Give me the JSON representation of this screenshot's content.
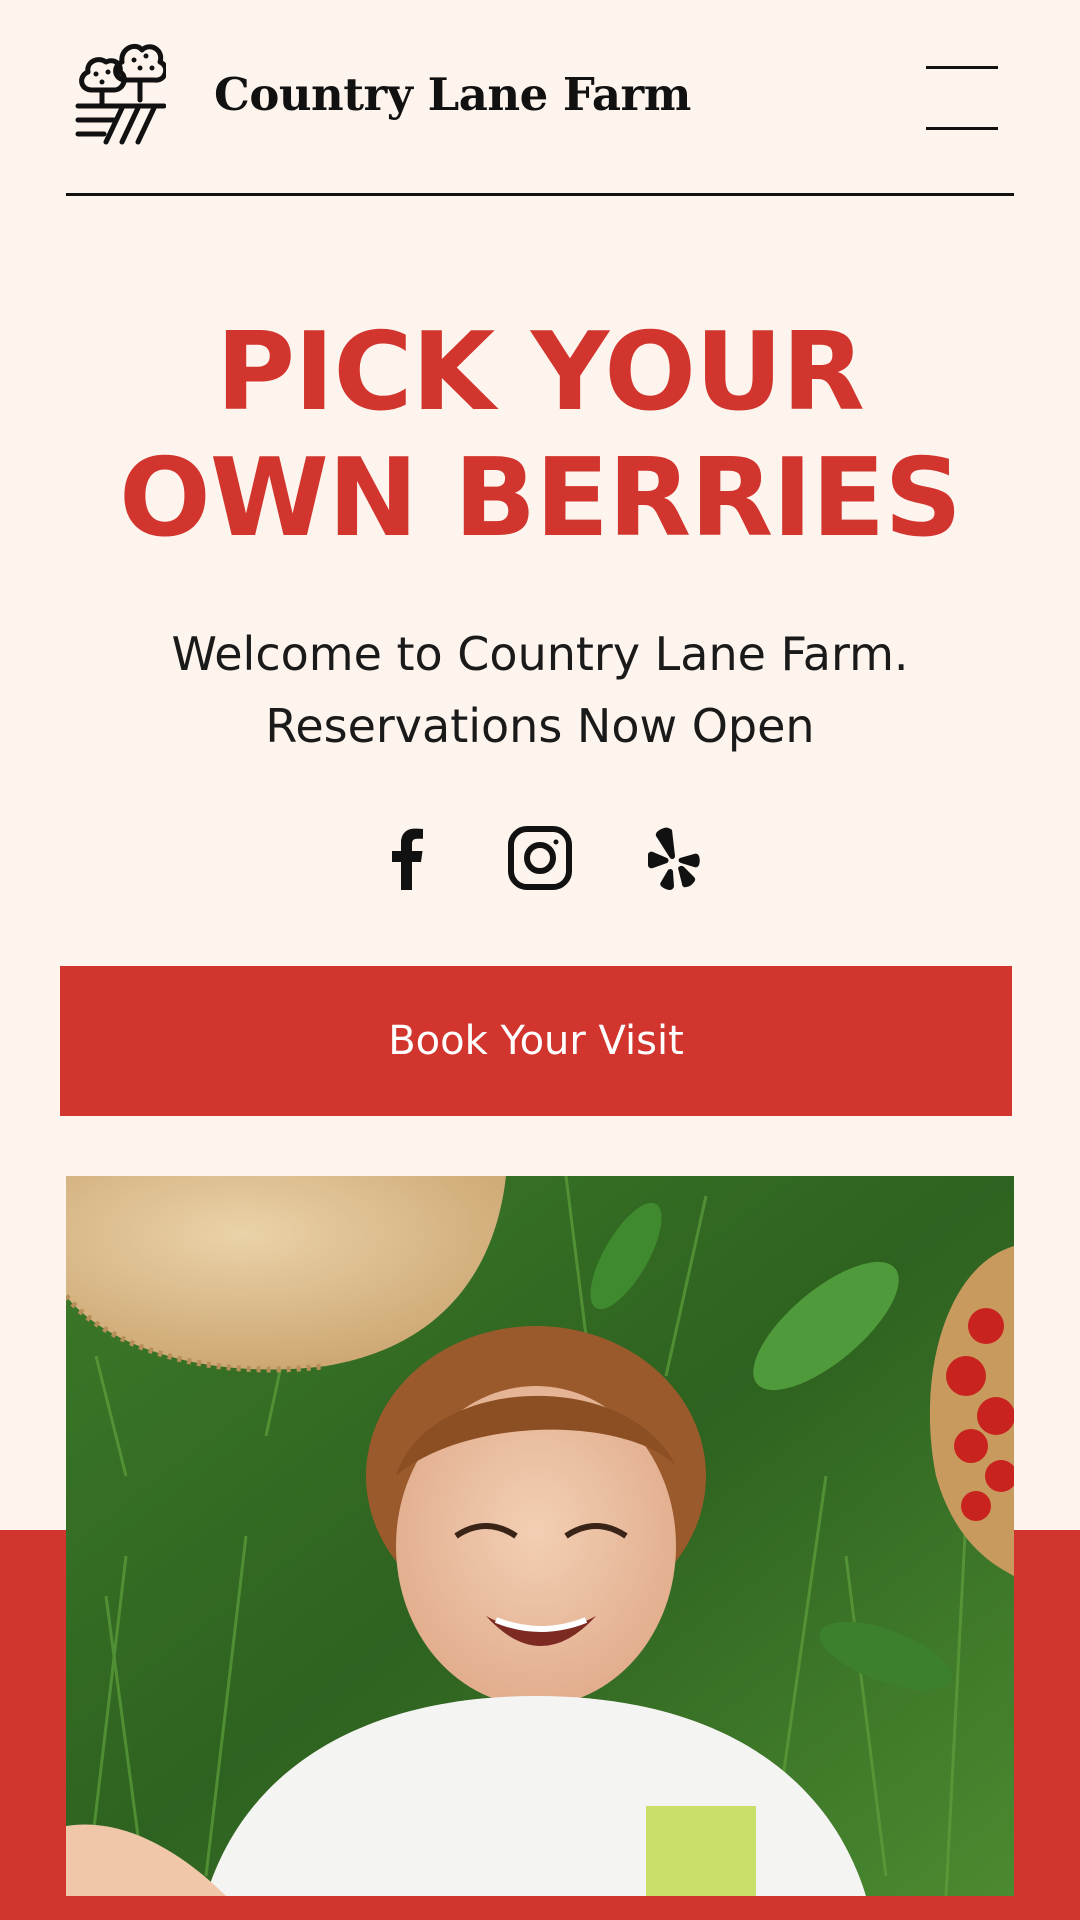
{
  "header": {
    "brand_name": "Country Lane Farm",
    "logo_icon": "farm-trees-field-icon",
    "menu_icon": "hamburger-menu-icon"
  },
  "hero": {
    "headline_line1": "PICK YOUR",
    "headline_line2": "OWN BERRIES",
    "subtitle_line1": "Welcome to Country Lane Farm.",
    "subtitle_line2": "Reservations Now Open"
  },
  "social": {
    "icons": [
      "facebook-icon",
      "instagram-icon",
      "yelp-icon"
    ]
  },
  "cta": {
    "label": "Book Your Visit"
  },
  "colors": {
    "background": "#fdf4ed",
    "accent_red": "#d2352e",
    "text_dark": "#111111",
    "button_text": "#ffffff"
  },
  "image": {
    "subject": "smiling child lying on grass with straw hat and basket of strawberries"
  }
}
